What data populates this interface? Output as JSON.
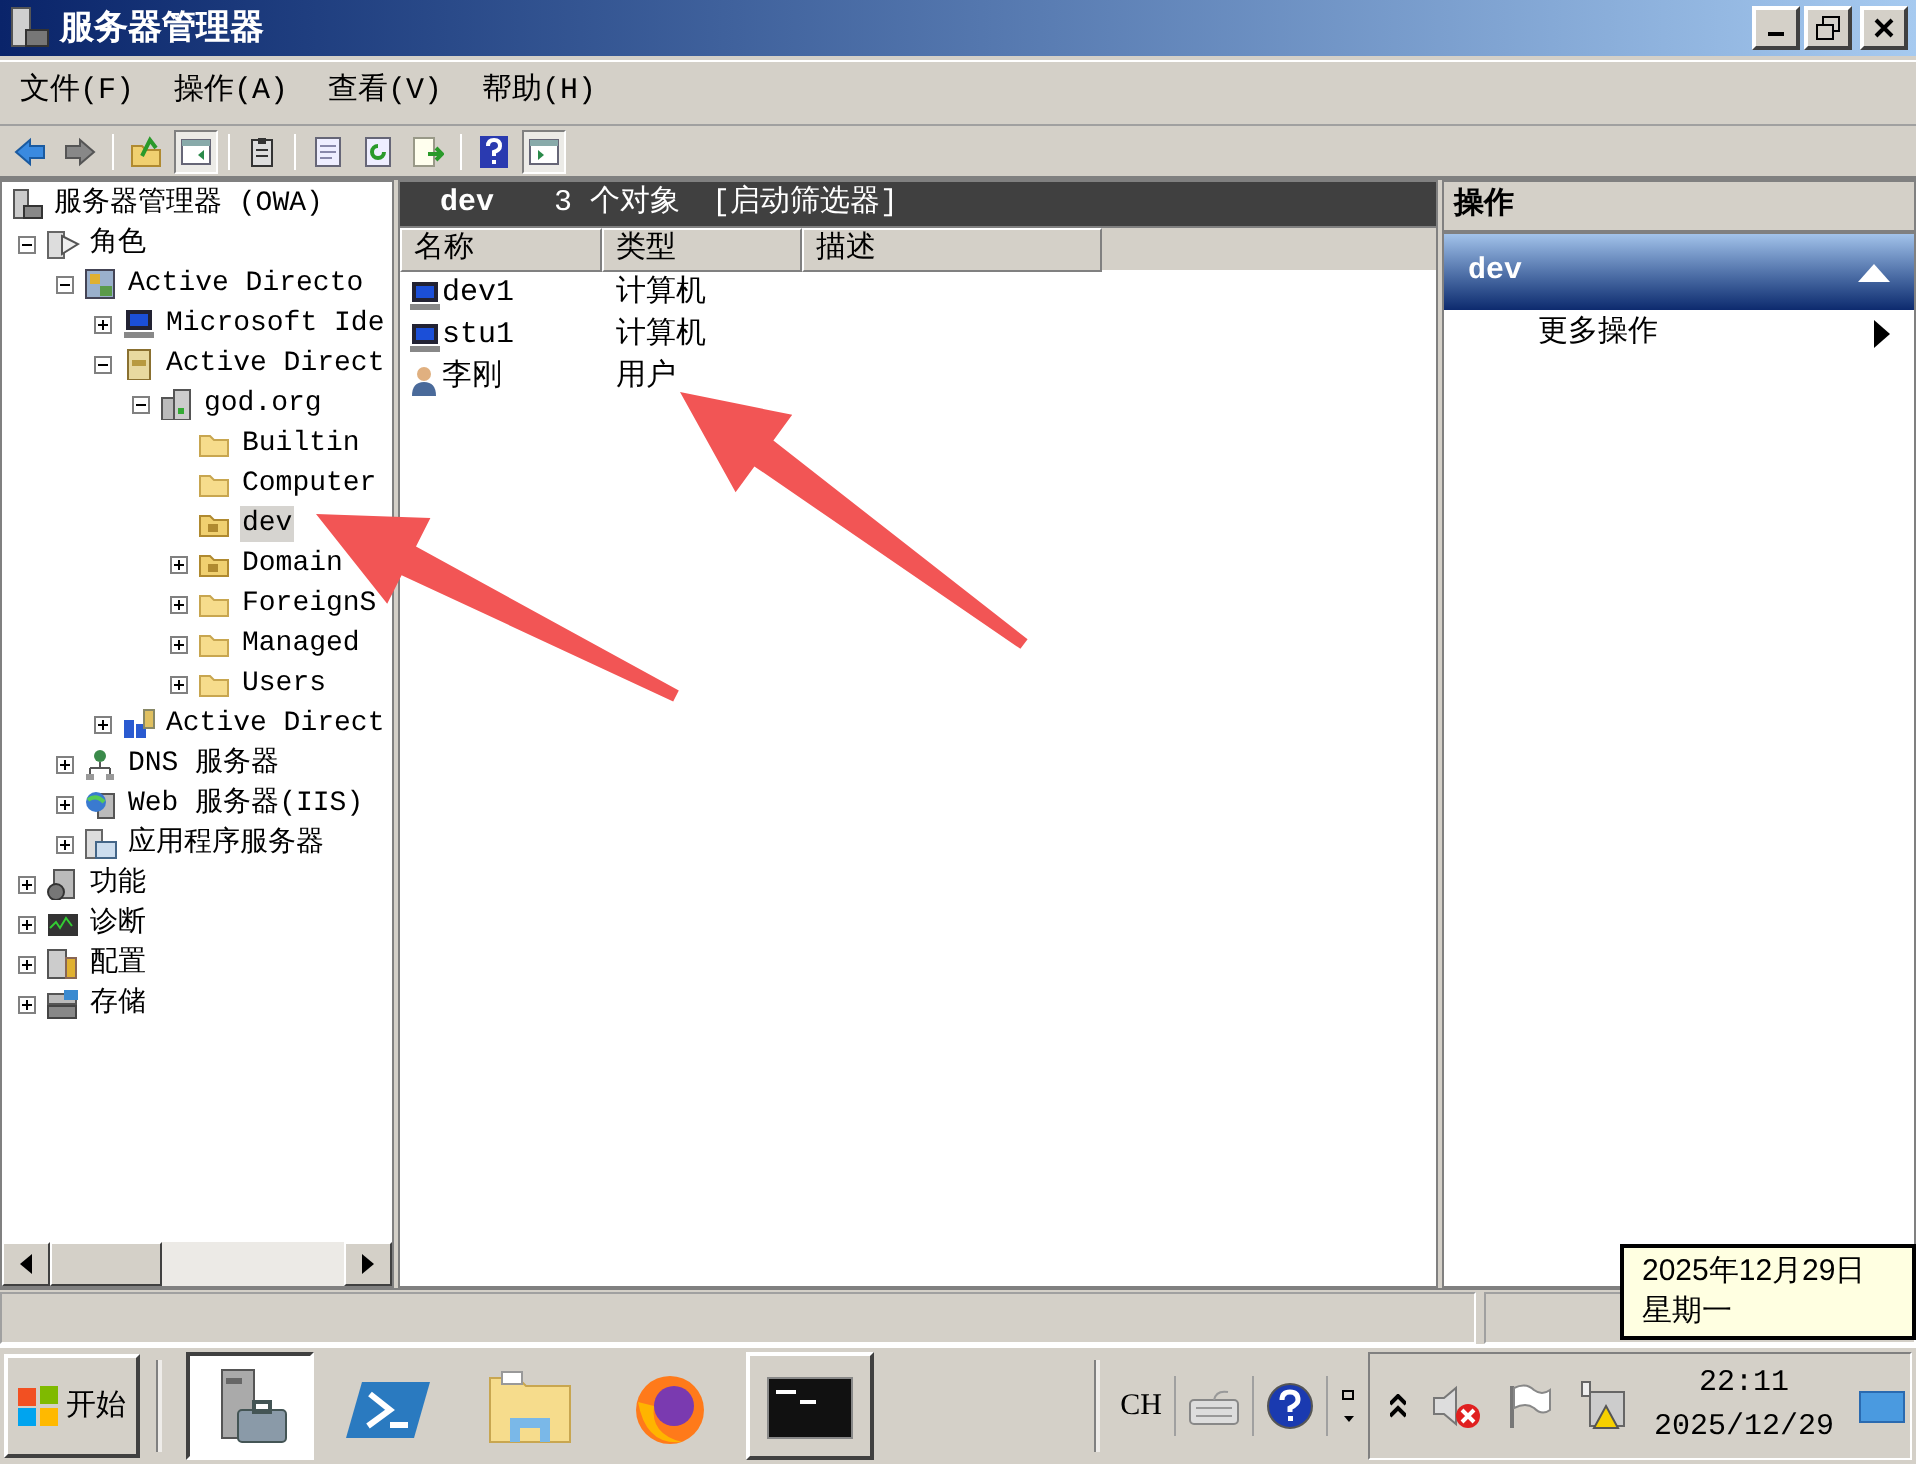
{
  "window": {
    "title": "服务器管理器"
  },
  "menu": [
    "文件(F)",
    "操作(A)",
    "查看(V)",
    "帮助(H)"
  ],
  "toolbar": [
    {
      "kind": "back",
      "pressed": false
    },
    {
      "kind": "forward",
      "pressed": false
    },
    {
      "kind": "separator"
    },
    {
      "kind": "up",
      "pressed": false
    },
    {
      "kind": "tree-toggle",
      "pressed": true
    },
    {
      "kind": "separator"
    },
    {
      "kind": "clipboard",
      "pressed": false
    },
    {
      "kind": "separator"
    },
    {
      "kind": "properties",
      "pressed": false
    },
    {
      "kind": "refresh",
      "pressed": false
    },
    {
      "kind": "export",
      "pressed": false
    },
    {
      "kind": "separator"
    },
    {
      "kind": "help",
      "pressed": false
    },
    {
      "kind": "action-toggle",
      "pressed": true
    }
  ],
  "tree": {
    "label": "服务器管理器 (OWA)",
    "kind": "server",
    "selected": false,
    "children": [
      {
        "label": "角色",
        "kind": "roles",
        "selected": false,
        "expanded": true,
        "children": [
          {
            "label": "Active Directo",
            "kind": "ad",
            "selected": false,
            "expanded": true,
            "children": [
              {
                "label": "Microsoft Ide",
                "kind": "computer",
                "selected": false,
                "expanded": false
              },
              {
                "label": "Active Direct",
                "kind": "book",
                "selected": false,
                "expanded": true,
                "children": [
                  {
                    "label": "god.org",
                    "kind": "domain",
                    "selected": false,
                    "expanded": true,
                    "children": [
                      {
                        "label": "Builtin",
                        "kind": "folder",
                        "selected": false
                      },
                      {
                        "label": "Computer",
                        "kind": "folder",
                        "selected": false
                      },
                      {
                        "label": "dev",
                        "kind": "ou",
                        "selected": true
                      },
                      {
                        "label": "Domain",
                        "kind": "ou",
                        "selected": false,
                        "expanded": false
                      },
                      {
                        "label": "ForeignS",
                        "kind": "folder",
                        "selected": false,
                        "expanded": false
                      },
                      {
                        "label": "Managed",
                        "kind": "folder",
                        "selected": false,
                        "expanded": false
                      },
                      {
                        "label": "Users",
                        "kind": "folder",
                        "selected": false,
                        "expanded": false
                      }
                    ]
                  }
                ]
              },
              {
                "label": "Active Direct",
                "kind": "sites",
                "selected": false,
                "expanded": false
              }
            ]
          },
          {
            "label": "DNS 服务器",
            "kind": "dns",
            "selected": false,
            "expanded": false
          },
          {
            "label": "Web 服务器(IIS)",
            "kind": "web",
            "selected": false,
            "expanded": false
          },
          {
            "label": "应用程序服务器",
            "kind": "app",
            "selected": false,
            "expanded": false
          }
        ]
      },
      {
        "label": "功能",
        "kind": "features",
        "selected": false,
        "expanded": false
      },
      {
        "label": "诊断",
        "kind": "diagnostics",
        "selected": false,
        "expanded": false
      },
      {
        "label": "配置",
        "kind": "config",
        "selected": false,
        "expanded": false
      },
      {
        "label": "存储",
        "kind": "storage",
        "selected": false,
        "expanded": false
      }
    ]
  },
  "list_header": {
    "title": "dev",
    "count": "3 个对象",
    "filter": "[启动筛选器]"
  },
  "list": {
    "columns": [
      "名称",
      "类型",
      "描述"
    ],
    "rows": [
      {
        "kind": "computer",
        "name": "dev1",
        "type": "计算机",
        "selected": false
      },
      {
        "kind": "computer",
        "name": "stu1",
        "type": "计算机",
        "selected": false
      },
      {
        "kind": "user",
        "name": "李刚",
        "type": "用户",
        "selected": false
      }
    ]
  },
  "actions": {
    "title": "操作",
    "section": {
      "label": "dev",
      "expanded": true
    },
    "items": [
      "更多操作"
    ]
  },
  "taskbar": {
    "start": "开始",
    "apps": [
      {
        "kind": "server-manager",
        "selected": true,
        "open": true
      },
      {
        "kind": "powershell",
        "selected": false,
        "open": false
      },
      {
        "kind": "explorer",
        "selected": false,
        "open": false
      },
      {
        "kind": "firefox",
        "selected": false,
        "open": false
      },
      {
        "kind": "cmd",
        "selected": false,
        "open": true
      }
    ],
    "language": "CH",
    "clock": {
      "time": "22:11",
      "date": "2025/12/29"
    }
  },
  "tooltip": {
    "lines": [
      "2025年12月29日",
      "星期一"
    ]
  }
}
